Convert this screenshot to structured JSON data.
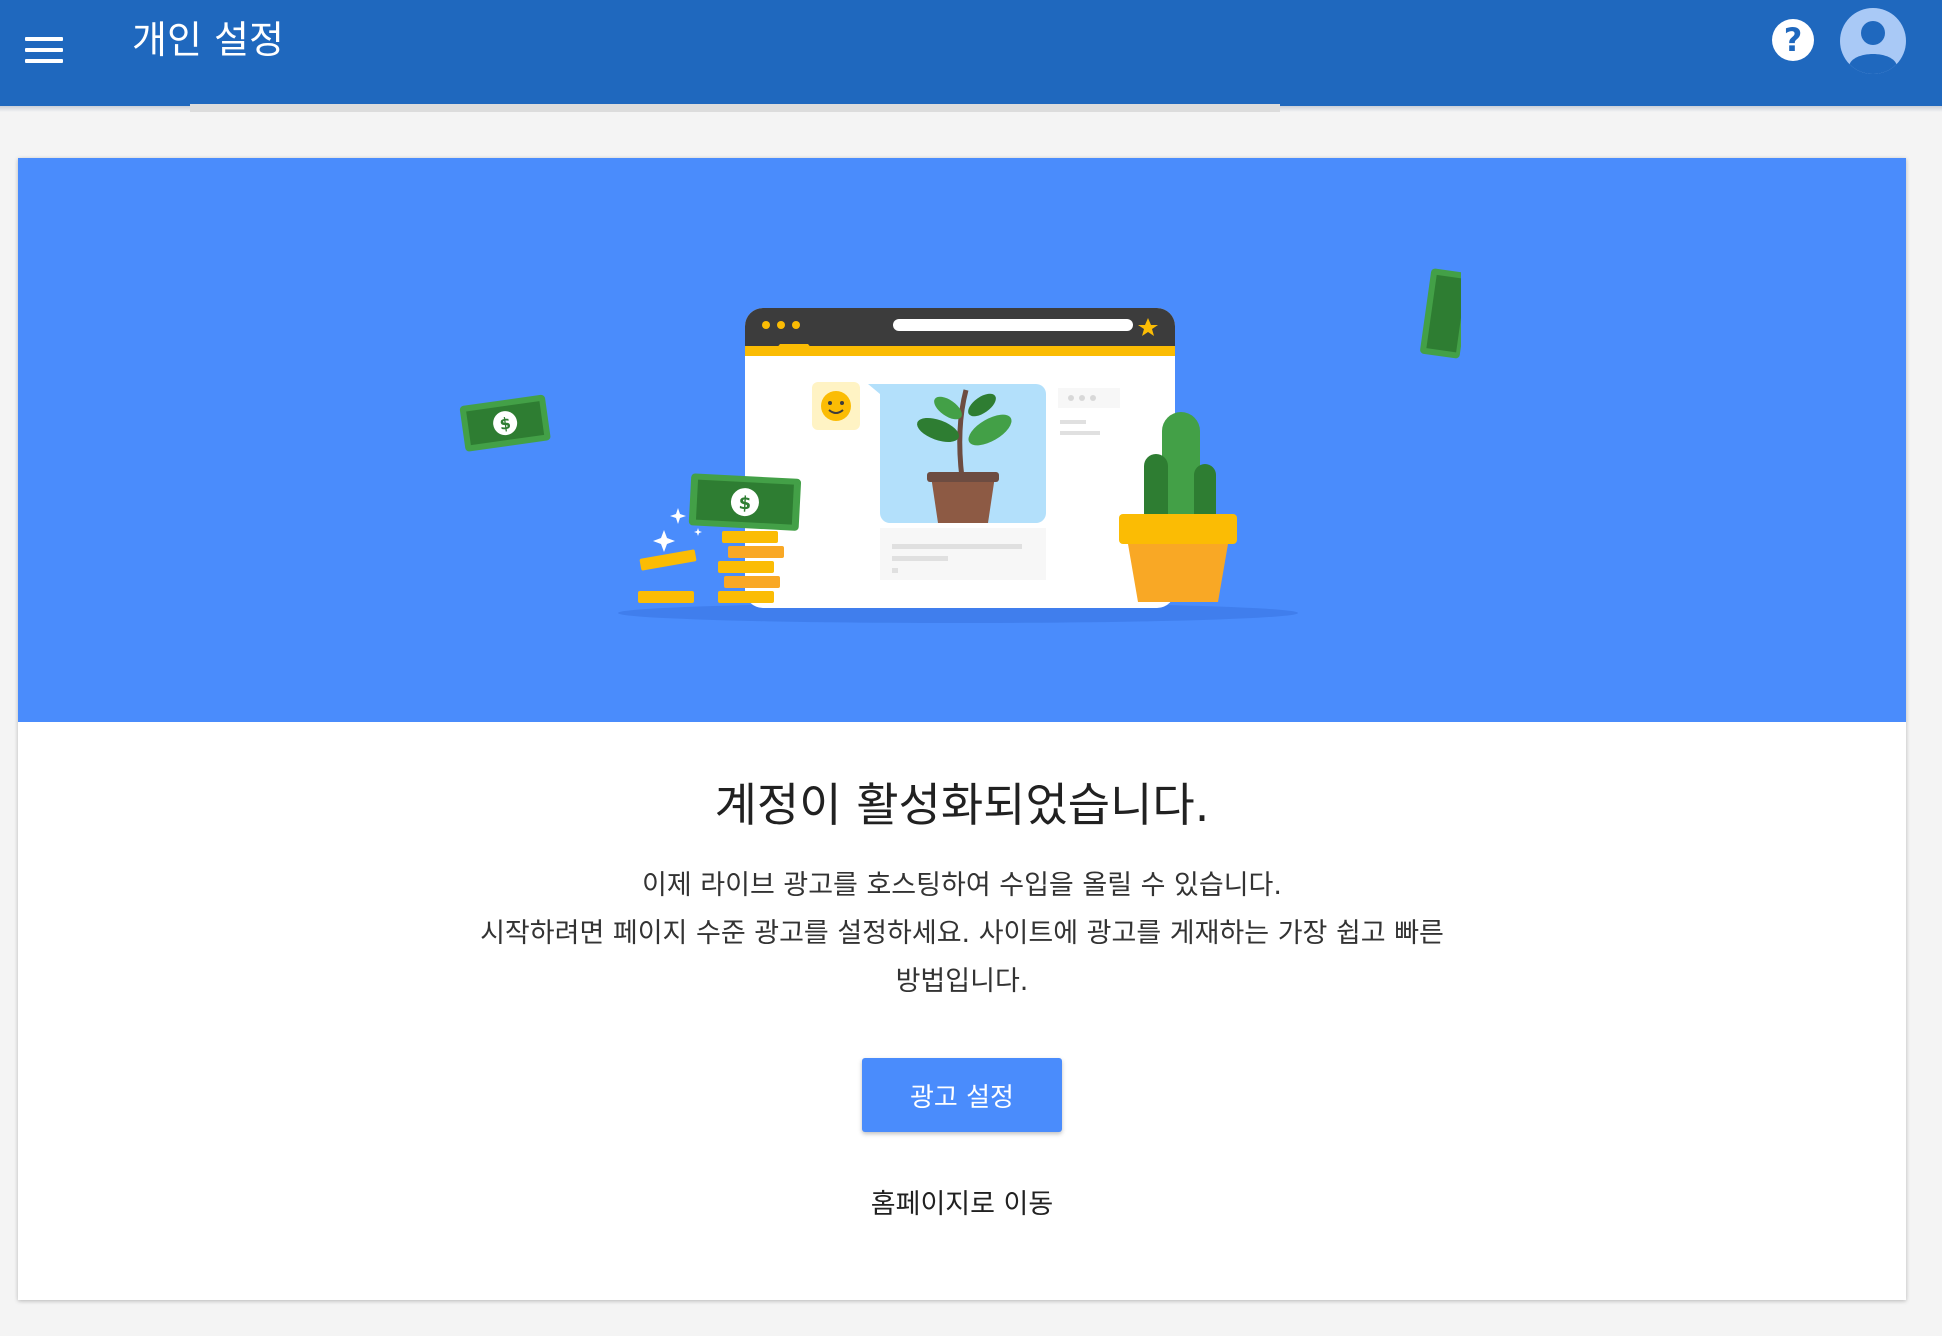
{
  "header": {
    "title": "개인 설정",
    "menu_icon": "menu-icon",
    "help_icon": "help-icon",
    "help_glyph": "?",
    "avatar_icon": "account-avatar-icon"
  },
  "colors": {
    "appbar": "#1f68be",
    "hero_background": "#4a8cfc",
    "primary_button": "#4a8cfc",
    "money_green": "#43a047",
    "coin_gold": "#fbbc04"
  },
  "hero": {
    "illustration": "browser-window-plant-money-illustration"
  },
  "main": {
    "headline": "계정이 활성화되었습니다.",
    "body_lines": [
      "이제 라이브 광고를 호스팅하여 수입을 올릴 수 있습니다.",
      "시작하려면 페이지 수준 광고를 설정하세요. 사이트에 광고를 게재하는 가장 쉽고 빠른",
      "방법입니다."
    ],
    "primary_button": "광고 설정",
    "secondary_link": "홈페이지로 이동"
  }
}
